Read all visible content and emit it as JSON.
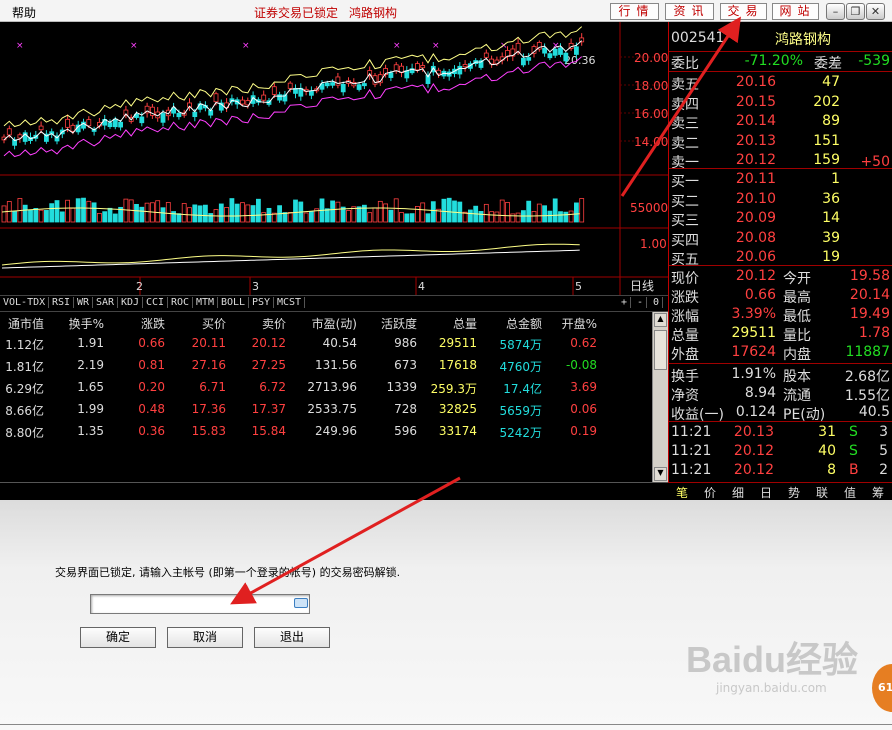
{
  "topbar": {
    "menu_help": "帮助",
    "lock_status": "证券交易已锁定",
    "stock_title": "鸿路钢构",
    "buttons": [
      "行情",
      "资讯",
      "交易",
      "网站"
    ]
  },
  "chart": {
    "price_axis": [
      "20.00",
      "18.00",
      "16.00",
      "14.00"
    ],
    "last_price_label": "20.36",
    "volume_axis": "55000",
    "indicator_axis": "1.00",
    "period_label": "日线",
    "x_ticks": [
      "2",
      "3",
      "4",
      "5"
    ]
  },
  "indicator_tabs": [
    "VOL-TDX",
    "RSI",
    "WR",
    "SAR",
    "KDJ",
    "CCI",
    "ROC",
    "MTM",
    "BOLL",
    "PSY",
    "MCST"
  ],
  "indicator_controls": [
    "+",
    "-",
    "0"
  ],
  "table": {
    "headers": [
      "通市值",
      "换手%",
      "涨跌",
      "买价",
      "卖价",
      "市盈(动)",
      "活跃度",
      "总量",
      "总金额",
      "开盘%"
    ],
    "rows": [
      [
        "1.12亿",
        "1.91",
        "0.66",
        "20.11",
        "20.12",
        "40.54",
        "986",
        "29511",
        "5874万",
        "0.62"
      ],
      [
        "1.81亿",
        "2.19",
        "0.81",
        "27.16",
        "27.25",
        "131.56",
        "673",
        "17618",
        "4760万",
        "-0.08"
      ],
      [
        "6.29亿",
        "1.65",
        "0.20",
        "6.71",
        "6.72",
        "2713.96",
        "1339",
        "259.3万",
        "17.4亿",
        "3.69"
      ],
      [
        "8.66亿",
        "1.99",
        "0.48",
        "17.36",
        "17.37",
        "2533.75",
        "728",
        "32825",
        "5659万",
        "0.06"
      ],
      [
        "8.80亿",
        "1.35",
        "0.36",
        "15.83",
        "15.84",
        "249.96",
        "596",
        "33174",
        "5242万",
        "0.19"
      ]
    ]
  },
  "quote": {
    "code": "002541",
    "name": "鸿路钢构",
    "weibi_label": "委比",
    "weibi_value": "-71.20%",
    "weicha_label": "委差",
    "weicha_value": "-539",
    "asks": [
      {
        "label": "卖五",
        "price": "20.16",
        "vol": "47",
        "extra": ""
      },
      {
        "label": "卖四",
        "price": "20.15",
        "vol": "202",
        "extra": ""
      },
      {
        "label": "卖三",
        "price": "20.14",
        "vol": "89",
        "extra": ""
      },
      {
        "label": "卖二",
        "price": "20.13",
        "vol": "151",
        "extra": ""
      },
      {
        "label": "卖一",
        "price": "20.12",
        "vol": "159",
        "extra": "+50"
      }
    ],
    "bids": [
      {
        "label": "买一",
        "price": "20.11",
        "vol": "1"
      },
      {
        "label": "买二",
        "price": "20.10",
        "vol": "36"
      },
      {
        "label": "买三",
        "price": "20.09",
        "vol": "14"
      },
      {
        "label": "买四",
        "price": "20.08",
        "vol": "39"
      },
      {
        "label": "买五",
        "price": "20.06",
        "vol": "19"
      }
    ],
    "stats": [
      {
        "l1": "现价",
        "v1": "20.12",
        "l2": "今开",
        "v2": "19.58"
      },
      {
        "l1": "涨跌",
        "v1": "0.66",
        "l2": "最高",
        "v2": "20.14"
      },
      {
        "l1": "涨幅",
        "v1": "3.39%",
        "l2": "最低",
        "v2": "19.49"
      },
      {
        "l1": "总量",
        "v1": "29511",
        "l2": "量比",
        "v2": "1.78"
      },
      {
        "l1": "外盘",
        "v1": "17624",
        "l2": "内盘",
        "v2": "11887"
      }
    ],
    "stats2": [
      {
        "l1": "换手",
        "v1": "1.91%",
        "l2": "股本",
        "v2": "2.68亿"
      },
      {
        "l1": "净资",
        "v1": "8.94",
        "l2": "流通",
        "v2": "1.55亿"
      },
      {
        "l1": "收益(一)",
        "v1": "0.124",
        "l2": "PE(动)",
        "v2": "40.5"
      }
    ],
    "ticks": [
      {
        "time": "11:21",
        "price": "20.13",
        "vol": "31",
        "side": "S",
        "n": "3"
      },
      {
        "time": "11:21",
        "price": "20.12",
        "vol": "40",
        "side": "S",
        "n": "5"
      },
      {
        "time": "11:21",
        "price": "20.12",
        "vol": "8",
        "side": "B",
        "n": "2"
      }
    ],
    "tabs": [
      "笔",
      "价",
      "细",
      "日",
      "势",
      "联",
      "值",
      "筹"
    ]
  },
  "lock": {
    "message": "交易界面已锁定, 请输入主帐号 (即第一个登录的帐号) 的交易密码解锁.",
    "ok": "确定",
    "cancel": "取消",
    "exit": "退出"
  },
  "watermark": {
    "brand": "Baidu经验",
    "url": "jingyan.baidu.com",
    "badge": "61"
  },
  "colors": {
    "up": "#ff4040",
    "down": "#22dddd",
    "accent": "#c00000",
    "arrow": "#e02020"
  }
}
